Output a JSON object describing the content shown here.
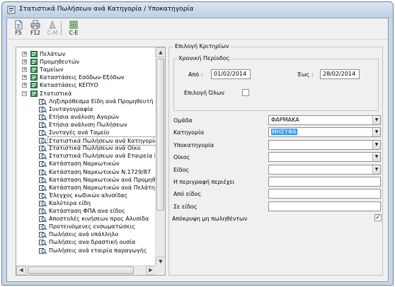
{
  "window": {
    "title": "Στατιστικά Πωλήσεων ανά Κατηγορία / Υποκατηγορία"
  },
  "toolbar": {
    "buttons": [
      {
        "label": "F5",
        "icon": "document-icon",
        "enabled": true
      },
      {
        "label": "F12",
        "icon": "printer-icon",
        "enabled": true
      },
      {
        "label": "C-M",
        "icon": "clear-icon",
        "enabled": false
      },
      {
        "label": "C-E",
        "icon": "export-icon",
        "enabled": true
      }
    ]
  },
  "tree": {
    "items": [
      {
        "label": "Πελάτων",
        "type": "folder",
        "expander": "+"
      },
      {
        "label": "Προμηθευτών",
        "type": "folder",
        "expander": "+"
      },
      {
        "label": "Ταμείων",
        "type": "folder",
        "expander": "+"
      },
      {
        "label": "Καταστάσεις Εσόδων-Εξόδων",
        "type": "folder",
        "expander": "+"
      },
      {
        "label": "Καταστάσεις ΚΕΠΥΟ",
        "type": "folder",
        "expander": "+"
      },
      {
        "label": "Στατιστικά",
        "type": "folder",
        "expander": "−"
      },
      {
        "label": "Ληξιπρόθεσμα Είδη ανά Προμηθευτή",
        "type": "report"
      },
      {
        "label": "Συνταγογραφία",
        "type": "report"
      },
      {
        "label": "Ετήσια ανάλυση Αγορών",
        "type": "report"
      },
      {
        "label": "Ετήσια ανάλυση Πωλήσεων",
        "type": "report"
      },
      {
        "label": "Συνταγές ανά Ταμείο",
        "type": "report"
      },
      {
        "label": "Στατιστικά Πωλήσεων ανά Κατηγορία",
        "type": "report",
        "selected": true
      },
      {
        "label": "Στατιστικά Πωλήσεων ανά Οίκο",
        "type": "report"
      },
      {
        "label": "Στατιστικά Πωλήσεων ανά Εταιρεία Πα",
        "type": "report"
      },
      {
        "label": "Κατάσταση Ναρκωτικών",
        "type": "report"
      },
      {
        "label": "Κατάσταση Ναρκωτικών Ν.1729/87",
        "type": "report"
      },
      {
        "label": "Κατάσταση Ναρκωτικών ανά Προμηθε",
        "type": "report"
      },
      {
        "label": "Κατάσταση Ναρκωτικών ανά Πελάτη",
        "type": "report"
      },
      {
        "label": "Έλεγχος κωδικών αλυσίδας",
        "type": "report"
      },
      {
        "label": "Καλύτερα είδη",
        "type": "report"
      },
      {
        "label": "Κατάσταση ΦΠΑ ανα είδος",
        "type": "report"
      },
      {
        "label": "Αποστολές κινήσεων προς Αλυσίδα",
        "type": "report"
      },
      {
        "label": "Προτεινόμενες ενσωματώσεις",
        "type": "report"
      },
      {
        "label": "Πωλήσεις ανά υπάλληλο",
        "type": "report"
      },
      {
        "label": "Πωλήσεις ανα δραστική ουσία",
        "type": "report"
      },
      {
        "label": "Πωλήσεις ανά εταιρία παραγωγής",
        "type": "report"
      }
    ]
  },
  "criteria": {
    "group_label": "Επιλογή Κριτηρίων",
    "period": {
      "label": "Χρονική Περίοδος",
      "from_label": "Από :",
      "from_value": "01/02/2014",
      "to_label": "Έως :",
      "to_value": "28/02/2014",
      "all_label": "Επιλογή Όλων",
      "all_checked": false
    },
    "fields": [
      {
        "label": "Ομάδα",
        "kind": "combo",
        "value": "ΦΑΡΜΑΚΑ"
      },
      {
        "label": "Κατηγορία",
        "kind": "combo",
        "value": "ΜΗΣΥΦΑ",
        "highlight": true
      },
      {
        "label": "Υποκατηγορία",
        "kind": "combo",
        "value": ""
      },
      {
        "label": "Οίκος",
        "kind": "combo",
        "value": ""
      },
      {
        "label": "Είδος",
        "kind": "combo",
        "value": ""
      },
      {
        "label": "Η περιγραφή περιέχει",
        "kind": "text",
        "value": ""
      },
      {
        "label": "Από είδος",
        "kind": "text",
        "value": ""
      },
      {
        "label": "Σε είδος",
        "kind": "text",
        "value": ""
      }
    ],
    "hide_unsold": {
      "label": "Απόκρυψη μη πωληθέντων",
      "checked": true
    }
  }
}
